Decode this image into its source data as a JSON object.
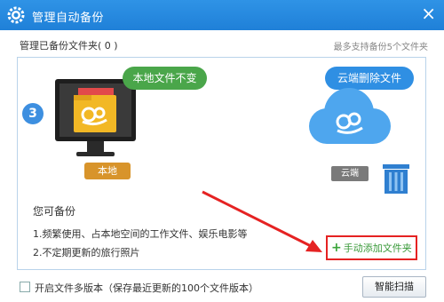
{
  "window": {
    "title": "管理自动备份",
    "app_icon": "gear-icon",
    "close_label": "×"
  },
  "header": {
    "folder_count_label": "管理已备份文件夹( 0 )",
    "limit_note": "最多支持备份5个文件夹"
  },
  "illustration": {
    "step_number": "3",
    "local_bubble": "本地文件不变",
    "local_tag": "本地",
    "cloud_bubble": "云端删除文件",
    "cloud_tag": "云端",
    "colors": {
      "green": "#4aa64a",
      "blue": "#2f8fe3",
      "orange": "#d8942b",
      "folder": "#f2b825"
    }
  },
  "content": {
    "heading": "您可备份",
    "items": [
      "1.频繁使用、占本地空间的工作文件、娱乐电影等",
      "2.不定期更新的旅行照片"
    ],
    "add_folder_label": "手动添加文件夹"
  },
  "footer": {
    "multi_version_label": "开启文件多版本（保存最近更新的100个文件版本）",
    "scan_button": "智能扫描"
  }
}
